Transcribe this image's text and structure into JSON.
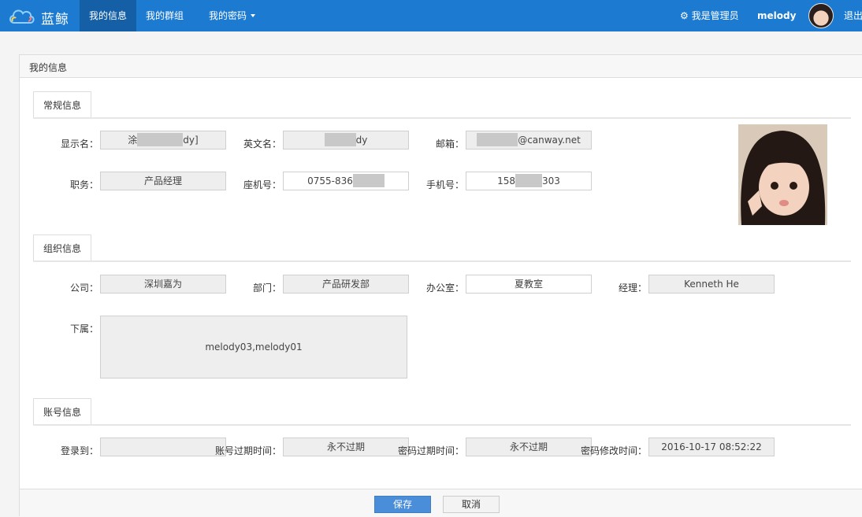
{
  "nav": {
    "brand": "蓝鲸",
    "items": [
      {
        "label": "我的信息",
        "active": true
      },
      {
        "label": "我的群组",
        "active": false
      },
      {
        "label": "我的密码",
        "active": false
      }
    ],
    "admin_label": "我是管理员",
    "username": "melody",
    "logout": "退出",
    "accent": "#1c7bd0"
  },
  "panel": {
    "title": "我的信息"
  },
  "general": {
    "tab": "常规信息",
    "display_name_label": "显示名：",
    "display_name_prefix": "涂",
    "display_name_suffix": "dy]",
    "english_name_label": "英文名：",
    "english_name_suffix": "dy",
    "email_label": "邮箱：",
    "email_suffix": "@canway.net",
    "position_label": "职务：",
    "position_value": "产品经理",
    "phone_label": "座机号：",
    "phone_prefix": "0755-836",
    "mobile_label": "手机号：",
    "mobile_prefix": "158",
    "mobile_suffix": "303"
  },
  "org": {
    "tab": "组织信息",
    "company_label": "公司：",
    "company_value": "深圳嘉为",
    "dept_label": "部门：",
    "dept_value": "产品研发部",
    "office_label": "办公室：",
    "office_value": "夏教室",
    "manager_label": "经理：",
    "manager_value": "Kenneth He",
    "subordinates_label": "下属：",
    "subordinates_value": "melody03,melody01"
  },
  "account": {
    "tab": "账号信息",
    "login_label": "登录到：",
    "login_value": "",
    "acct_expire_label": "账号过期时间：",
    "acct_expire_value": "永不过期",
    "pwd_expire_label": "密码过期时间：",
    "pwd_expire_value": "永不过期",
    "pwd_modified_label": "密码修改时间：",
    "pwd_modified_value": "2016-10-17 08:52:22"
  },
  "footer": {
    "save": "保存",
    "cancel": "取消"
  }
}
